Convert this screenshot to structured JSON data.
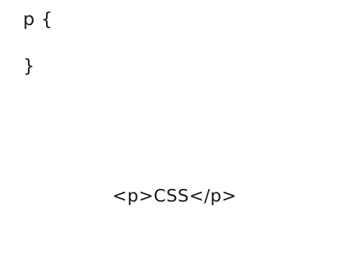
{
  "editor": {
    "lines": [
      "p {",
      "}"
    ]
  },
  "preview": {
    "markup": "<p>CSS</p>"
  },
  "colors": {
    "background": "#ffffff",
    "text": "#1a1a1a"
  }
}
